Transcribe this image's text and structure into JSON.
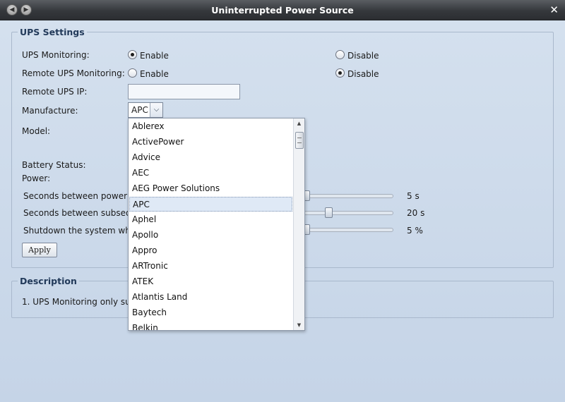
{
  "window": {
    "title": "Uninterrupted Power Source"
  },
  "ups_settings": {
    "legend": "UPS Settings",
    "ups_monitoring": {
      "label": "UPS Monitoring:",
      "enable": "Enable",
      "disable": "Disable",
      "selected": "Enable"
    },
    "remote_monitoring": {
      "label": "Remote UPS Monitoring:",
      "enable": "Enable",
      "disable": "Disable",
      "selected": "Disable"
    },
    "remote_ip": {
      "label": "Remote UPS IP:",
      "value": ""
    },
    "manufacture": {
      "label": "Manufacture:",
      "value": "APC"
    },
    "model": {
      "label": "Model:"
    },
    "battery_status": {
      "label": "Battery Status:"
    },
    "power": {
      "label": "Power:"
    },
    "sliders": [
      {
        "label": "Seconds between power f",
        "value_text": "5 s"
      },
      {
        "label": "Seconds between subsequ",
        "value_text": "20 s"
      },
      {
        "label": "Shutdown the system whe",
        "value_text": "5 %"
      }
    ],
    "apply_label": "Apply"
  },
  "description": {
    "legend": "Description",
    "text": "1. UPS Monitoring only supp"
  },
  "manufacturer_dropdown": {
    "options": [
      "Ablerex",
      "ActivePower",
      "Advice",
      "AEC",
      "AEG Power Solutions",
      "APC",
      "Aphel",
      "Apollo",
      "Appro",
      "ARTronic",
      "ATEK",
      "Atlantis Land",
      "Baytech",
      "Belkin"
    ],
    "selected": "APC"
  },
  "icons": {
    "back": "back-arrow-icon",
    "forward": "forward-arrow-icon",
    "close": "close-icon",
    "dropdown": "chevron-down-icon"
  }
}
